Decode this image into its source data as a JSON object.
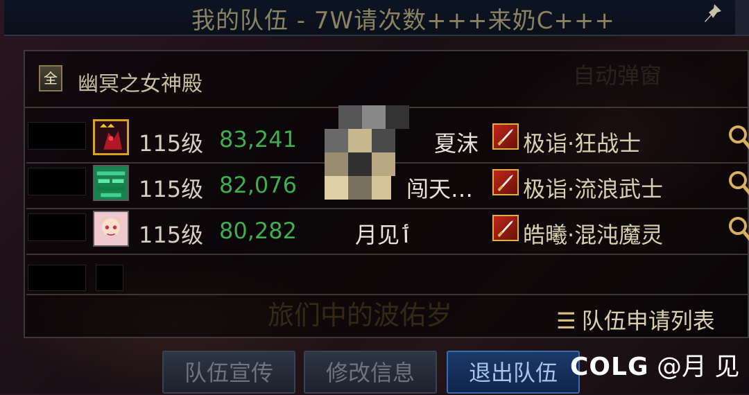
{
  "window": {
    "title": "我的队伍 - 7W请次数+++来奶C+++"
  },
  "panel": {
    "filter_icon_label": "全",
    "dungeon_name": "幽冥之女神殿",
    "auto_popup_label": "自动弹窗"
  },
  "members": [
    {
      "level": "115级",
      "score": "83,241",
      "name": "夏沫",
      "class": "极诣·狂战士",
      "avatar": "berserker-avatar",
      "leader": true
    },
    {
      "level": "115级",
      "score": "82,076",
      "name": "闯天…",
      "class": "极诣·流浪武士",
      "avatar": "vagabond-avatar",
      "leader": false
    },
    {
      "level": "115级",
      "score": "80,282",
      "name": "月见ٲ",
      "class": "皓曦·混沌魔灵",
      "avatar": "chaos-avatar",
      "leader": false
    }
  ],
  "apply_list_label": "队伍申请列表",
  "background_text": "旅们中的波佑岁",
  "buttons": {
    "promote": "队伍宣传",
    "edit_info": "修改信息",
    "leave": "退出队伍"
  },
  "watermark": {
    "brand": "COLG",
    "handle": "@月 见"
  },
  "colors": {
    "score_green": "#3fae4e",
    "leader_gold": "#d4a420",
    "active_button_blue": "#1a3a6a"
  }
}
